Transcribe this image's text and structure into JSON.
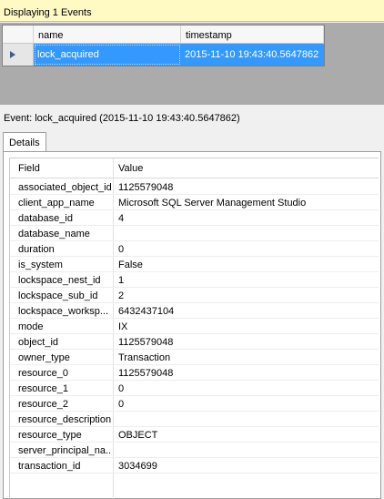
{
  "banner": {
    "text": "Displaying 1 Events"
  },
  "events_grid": {
    "columns": [
      "name",
      "timestamp"
    ],
    "rows": [
      {
        "name": "lock_acquired",
        "timestamp": "2015-11-10 19:43:40.5647862"
      }
    ]
  },
  "details": {
    "event_title": "Event: lock_acquired (2015-11-10 19:43:40.5647862)",
    "tab_label": "Details",
    "field_header": "Field",
    "value_header": "Value",
    "rows": [
      {
        "field": "associated_object_id",
        "value": "1125579048"
      },
      {
        "field": "client_app_name",
        "value": "Microsoft SQL Server Management Studio"
      },
      {
        "field": "database_id",
        "value": "4"
      },
      {
        "field": "database_name",
        "value": ""
      },
      {
        "field": "duration",
        "value": "0"
      },
      {
        "field": "is_system",
        "value": "False"
      },
      {
        "field": "lockspace_nest_id",
        "value": "1"
      },
      {
        "field": "lockspace_sub_id",
        "value": "2"
      },
      {
        "field": "lockspace_worksp...",
        "value": "6432437104"
      },
      {
        "field": "mode",
        "value": "IX"
      },
      {
        "field": "object_id",
        "value": "1125579048"
      },
      {
        "field": "owner_type",
        "value": "Transaction"
      },
      {
        "field": "resource_0",
        "value": "1125579048"
      },
      {
        "field": "resource_1",
        "value": "0"
      },
      {
        "field": "resource_2",
        "value": "0"
      },
      {
        "field": "resource_description",
        "value": ""
      },
      {
        "field": "resource_type",
        "value": "OBJECT"
      },
      {
        "field": "server_principal_na...",
        "value": ""
      },
      {
        "field": "transaction_id",
        "value": "3034699"
      }
    ]
  },
  "colors": {
    "selection": "#3399ff",
    "banner": "#fff9c4",
    "grid_background": "#ababab"
  }
}
